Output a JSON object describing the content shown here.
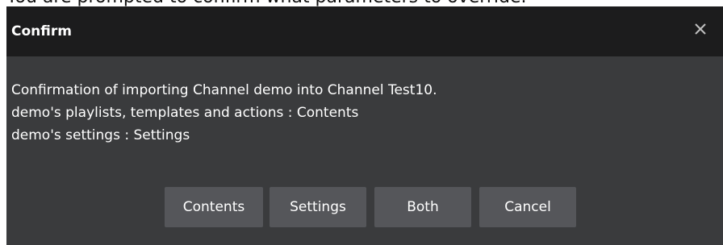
{
  "background_caption": "You are prompted to confirm what parameters to override.",
  "dialog": {
    "title": "Confirm",
    "close_icon": "close-icon",
    "message_lines": [
      "Confirmation of importing Channel demo into Channel Test10.",
      "demo's playlists, templates and actions : Contents",
      "demo's settings : Settings"
    ],
    "buttons": {
      "contents": "Contents",
      "settings": "Settings",
      "both": "Both",
      "cancel": "Cancel"
    }
  },
  "colors": {
    "titlebar": "#1c1c1d",
    "body": "#3a3b3d",
    "button": "#55565a",
    "text": "#ffffff"
  }
}
